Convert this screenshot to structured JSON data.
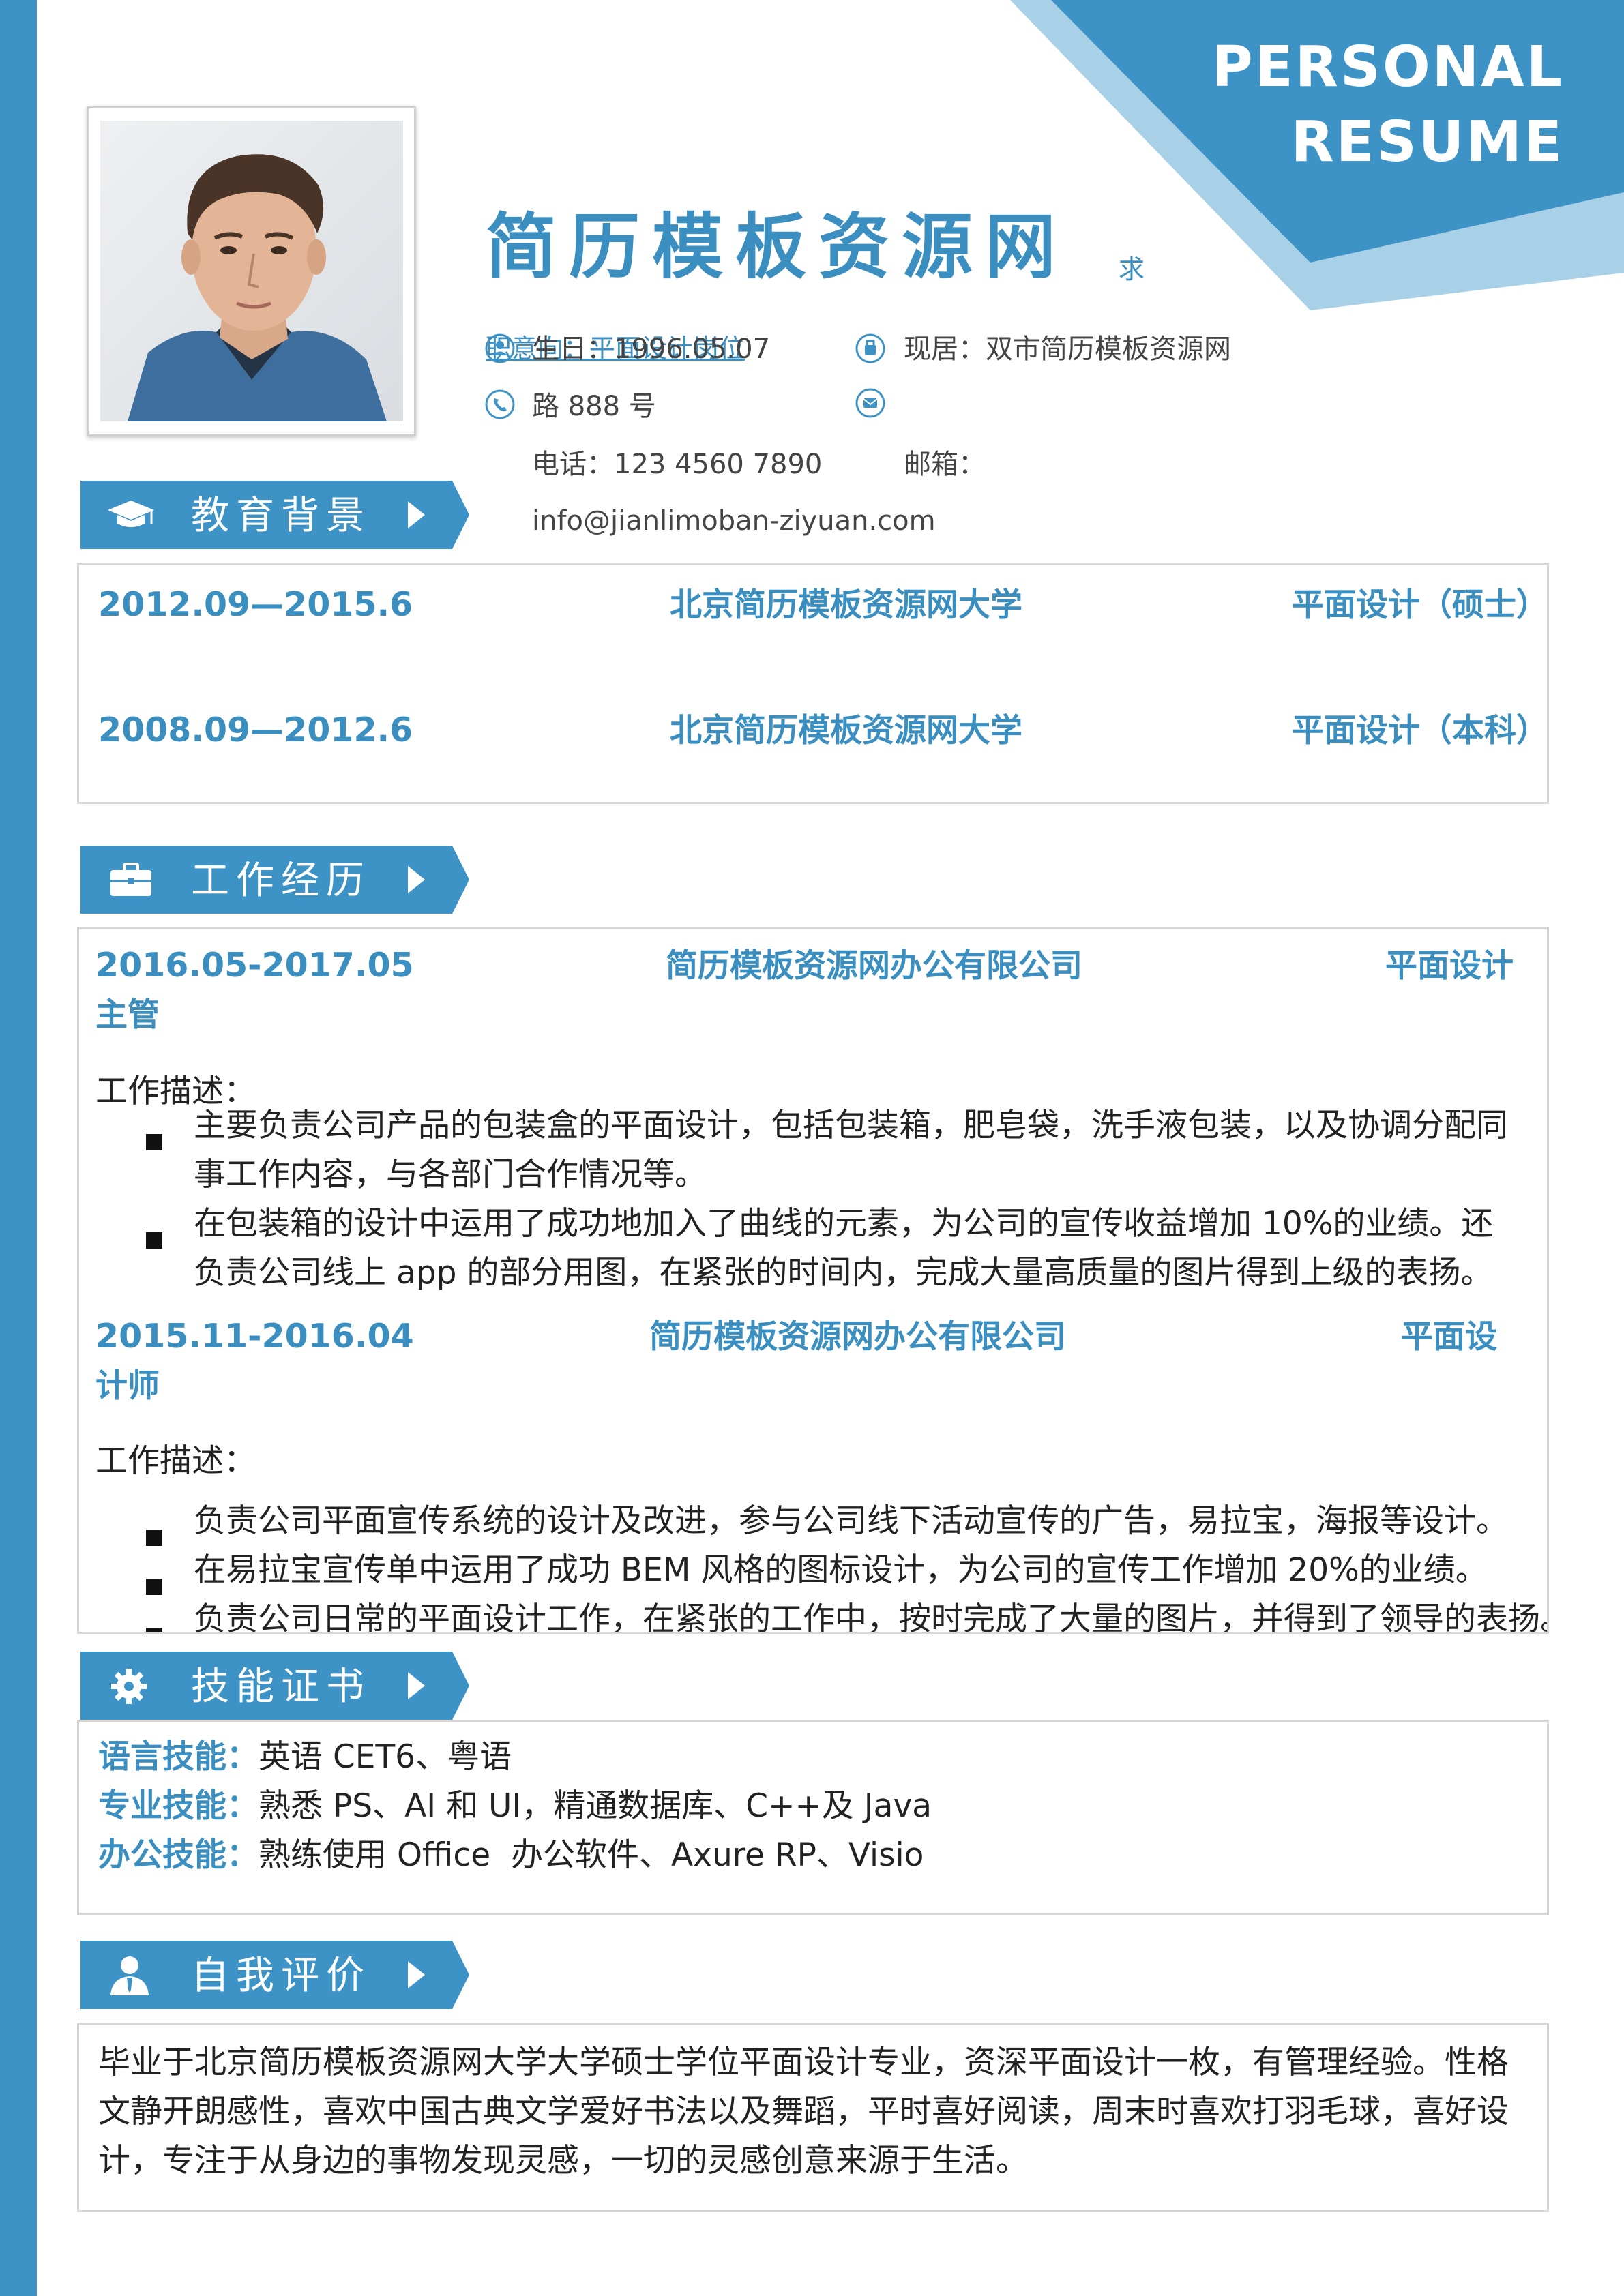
{
  "header": {
    "title_line1": "PERSONAL",
    "title_line2": "RESUME",
    "name": "简历模板资源网",
    "seek_label": "求",
    "intent": "职意向：平面设计岗位",
    "birth": "生日：1996.05.07",
    "residence": "现居：双市简历模板资源网",
    "address": "路 888 号",
    "phone": "电话：123 4560 7890",
    "email_label": "邮箱：",
    "email": "info@jianlimoban-ziyuan.com"
  },
  "sections": {
    "education": "教育背景",
    "work": "工作经历",
    "skills": "技能证书",
    "self_eval": "自我评价"
  },
  "education": [
    {
      "period": "2012.09—2015.6",
      "school": "北京简历模板资源网大学",
      "major": "平面设计（硕士）"
    },
    {
      "period": "2008.09—2012.6",
      "school": "北京简历模板资源网大学",
      "major": "平面设计（本科）"
    }
  ],
  "work": [
    {
      "period": "2016.05-2017.05",
      "company": "简历模板资源网办公有限公司",
      "position_part1": "平面设计",
      "position_part2": "主管",
      "desc_label": "工作描述：",
      "bullets": [
        {
          "line1": "主要负责公司产品的包装盒的平面设计，包括包装箱，肥皂袋，洗手液包装，以及协调分配同",
          "line2": "事工作内容，与各部门合作情况等。"
        },
        {
          "line1": "在包装箱的设计中运用了成功地加入了曲线的元素，为公司的宣传收益增加 10%的业绩。还",
          "line2": "负责公司线上 app 的部分用图，在紧张的时间内，完成大量高质量的图片得到上级的表扬。"
        }
      ]
    },
    {
      "period": "2015.11-2016.04",
      "company": "简历模板资源网办公有限公司",
      "position_part1": "平面设",
      "position_part2": "计师",
      "desc_label": "工作描述：",
      "bullets": [
        {
          "line1": "负责公司平面宣传系统的设计及改进，参与公司线下活动宣传的广告，易拉宝，海报等设计。"
        },
        {
          "line1": "在易拉宝宣传单中运用了成功 BEM 风格的图标设计，为公司的宣传工作增加 20%的业绩。"
        },
        {
          "line1": "负责公司日常的平面设计工作，在紧张的工作中，按时完成了大量的图片，并得到了领导的表扬。"
        }
      ]
    }
  ],
  "skills": [
    {
      "label": "语言技能：",
      "value": "英语 CET6、粤语"
    },
    {
      "label": "专业技能：",
      "value": "熟悉 PS、AI 和 UI，精通数据库、C++及 Java"
    },
    {
      "label": "办公技能：",
      "value": "熟练使用 Office  办公软件、Axure RP、Visio"
    }
  ],
  "self_eval": {
    "line1": "毕业于北京简历模板资源网大学大学硕士学位平面设计专业，资深平面设计一枚，有管理经验。性格",
    "line2": "文静开朗感性，喜欢中国古典文学爱好书法以及舞蹈，平时喜好阅读，周末时喜欢打羽毛球，喜好设",
    "line3": "计，专注于从身边的事物发现灵感，一切的灵感创意来源于生活。"
  },
  "icons": {
    "birth": "user-icon",
    "residence": "home-icon",
    "phone": "phone-icon",
    "email": "mail-icon",
    "education": "graduation-cap-icon",
    "work": "briefcase-icon",
    "skills": "gear-icon",
    "self_eval": "person-icon"
  },
  "colors": {
    "accent": "#3d93c6",
    "accent_light": "#a8d0e6",
    "text": "#222222",
    "border": "#d6d6d6"
  }
}
